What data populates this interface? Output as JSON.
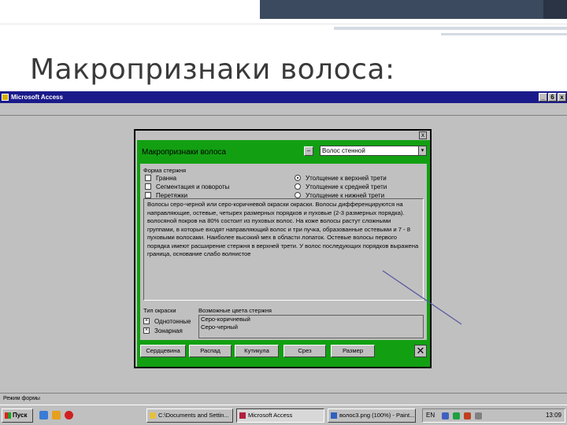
{
  "slide": {
    "title": "Макропризнаки волоса:"
  },
  "app": {
    "title": "Microsoft Access",
    "controls": {
      "minimize": "_",
      "restore": "6",
      "close": "x"
    },
    "status": "Режим формы"
  },
  "dialog": {
    "title": "Макропризнаки волоса",
    "close_glyph": "x",
    "minimize_glyph": "–",
    "combo_value": "Волос стенной",
    "combo_arrow": "▾",
    "shape_label": "Форма стержня",
    "checkboxes": [
      {
        "label": "Гранна"
      },
      {
        "label": "Сегментация и повороты"
      },
      {
        "label": "Перетяжки"
      }
    ],
    "radios": [
      {
        "label": "Утолщение к верхней трети",
        "selected": true
      },
      {
        "label": "Утолщение к средней трети",
        "selected": false
      },
      {
        "label": "Утолщение к нижней трети",
        "selected": false
      }
    ],
    "description": "Волосы серо-черной или серо-коричневой окраски окраски. Волосы дифференцируются на направляющие, остевые, четырех размерных порядков и пуховые (2-3 размерных порядка). волосяной покров на 80% состоит из пуховых волос. На коже волосы растут сложными группами, в которые входят направляющий волос и три пучка, образованные остевыми и 7 - 8 пуховыми волосами. Наиболее высокий мех в области лопаток. Остевые волосы первого порядка имеют расширение стержня в верхней трети. У волос последующих порядков выражена граница, основание слабо волнистое",
    "hair_type_label": "Тип окраски",
    "hair_colors_label": "Возможные цвета стержня",
    "hair_colors": [
      "Серо-коричневый",
      "Серо-черный"
    ],
    "hair_types": [
      {
        "label": "Однотонные",
        "checked": true
      },
      {
        "label": "Зонарная",
        "checked": true
      }
    ],
    "buttons": [
      "Сердцевина",
      "Распад",
      "Кутикула",
      "Срез",
      "Размер"
    ],
    "exit_glyph": "✕"
  },
  "taskbar": {
    "start_label": "Пуск",
    "tasks": [
      {
        "label": "C:\\Documents and Settin...",
        "active": false
      },
      {
        "label": "Microsoft Access",
        "active": true
      },
      {
        "label": "волос3.png (100%) - Paint...",
        "active": false
      }
    ],
    "lang": "EN",
    "clock": "13:09"
  },
  "colors": {
    "dialog_green": "#12a012",
    "titlebar_blue": "#1a1a8a",
    "window_gray": "#c0c0c0"
  }
}
